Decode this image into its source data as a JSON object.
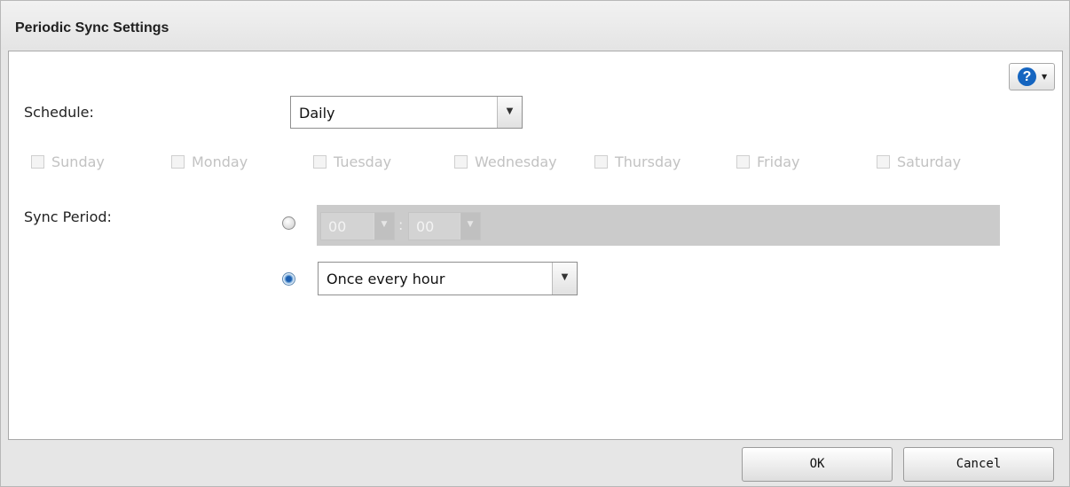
{
  "dialog": {
    "title": "Periodic Sync Settings"
  },
  "help": {
    "icon": "question-circle-icon",
    "glyph": "?",
    "caret": "▼",
    "color": "#1565c0"
  },
  "schedule": {
    "label": "Schedule:",
    "value": "Daily",
    "days": [
      {
        "label": "Sunday",
        "checked": false,
        "enabled": false
      },
      {
        "label": "Monday",
        "checked": false,
        "enabled": false
      },
      {
        "label": "Tuesday",
        "checked": false,
        "enabled": false
      },
      {
        "label": "Wednesday",
        "checked": false,
        "enabled": false
      },
      {
        "label": "Thursday",
        "checked": false,
        "enabled": false
      },
      {
        "label": "Friday",
        "checked": false,
        "enabled": false
      },
      {
        "label": "Saturday",
        "checked": false,
        "enabled": false
      }
    ]
  },
  "sync_period": {
    "label": "Sync Period:",
    "specific_time": {
      "selected": false,
      "enabled": false,
      "hour": "00",
      "separator": ":",
      "minute": "00"
    },
    "interval": {
      "selected": true,
      "value": "Once every hour"
    }
  },
  "footer": {
    "ok_label": "OK",
    "cancel_label": "Cancel"
  },
  "icons": {
    "dropdown": "chevron-down-icon",
    "dropdown_glyph": "▼"
  }
}
